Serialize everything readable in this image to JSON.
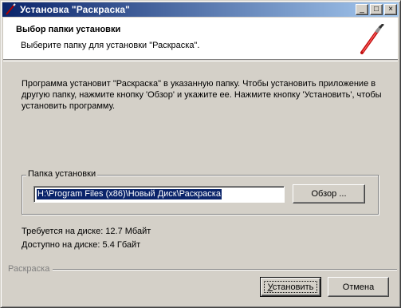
{
  "window": {
    "title": "Установка \"Раскраска\"",
    "buttons": {
      "minimize": "_",
      "maximize": "□",
      "close": "×"
    }
  },
  "header": {
    "title": "Выбор папки установки",
    "subtitle": "Выберите папку для установки \"Раскраска\"."
  },
  "intro": "Программа установит \"Раскраска\" в указанную папку. Чтобы установить приложение в другую папку, нажмите кнопку 'Обзор' и укажите ее. Нажмите кнопку 'Установить', чтобы установить программу.",
  "folder": {
    "group_label": "Папка установки",
    "path_value": "H:\\Program Files (x86)\\Новый Диск\\Раскраска",
    "browse_label": "Обзор ..."
  },
  "disk": {
    "required": "Требуется на диске: 12.7 Мбайт",
    "available": "Доступно на диске: 5.4 Гбайт"
  },
  "footer": {
    "brand": "Раскраска",
    "install_label_underlined": "У",
    "install_label_rest": "становить",
    "cancel_label": "Отмена"
  },
  "icons": {
    "title": "paintbrush-icon",
    "header": "paintbrush-icon"
  }
}
